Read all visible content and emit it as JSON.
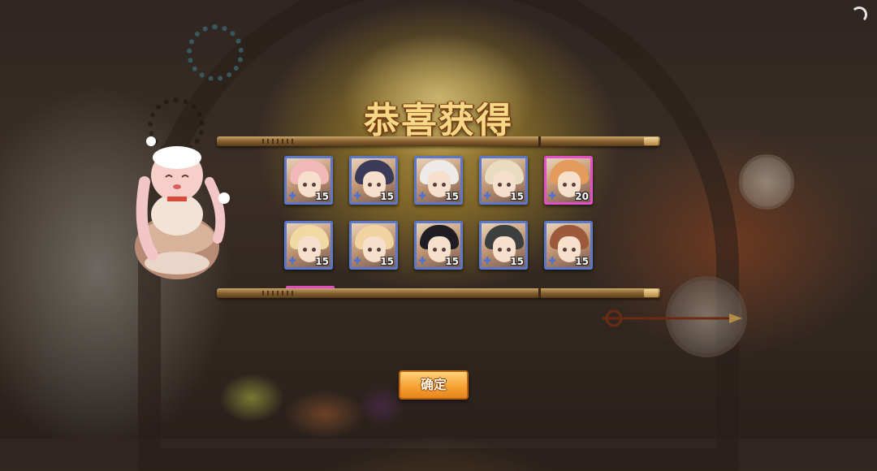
{
  "title": "恭喜获得",
  "confirm_button": {
    "label": "确定"
  },
  "rewards": [
    {
      "name": "hero-1",
      "count": "15",
      "frame": "blue",
      "hair": "#f2b8b8"
    },
    {
      "name": "hero-2",
      "count": "15",
      "frame": "blue",
      "hair": "#3b3a58"
    },
    {
      "name": "hero-3",
      "count": "15",
      "frame": "blue",
      "hair": "#eeeae8"
    },
    {
      "name": "hero-4",
      "count": "15",
      "frame": "blue",
      "hair": "#e9dcc0"
    },
    {
      "name": "hero-5",
      "count": "20",
      "frame": "pink",
      "hair": "#e49b5c"
    },
    {
      "name": "hero-6",
      "count": "15",
      "frame": "blue",
      "hair": "#f1d9a3"
    },
    {
      "name": "hero-7",
      "count": "15",
      "frame": "blue",
      "hair": "#f0d3a0"
    },
    {
      "name": "hero-8",
      "count": "15",
      "frame": "blue",
      "hair": "#1f1c22"
    },
    {
      "name": "hero-9",
      "count": "15",
      "frame": "blue",
      "hair": "#3c3f3d"
    },
    {
      "name": "hero-10",
      "count": "15",
      "frame": "blue",
      "hair": "#9c5a3a"
    }
  ],
  "icons": {
    "shard": "puzzle-piece-icon",
    "loading": "loading-spinner-icon"
  },
  "colors": {
    "title": "#f6d887",
    "button": "#f7a334",
    "frame_blue": "#5d78c8",
    "frame_pink": "#e050c8"
  }
}
